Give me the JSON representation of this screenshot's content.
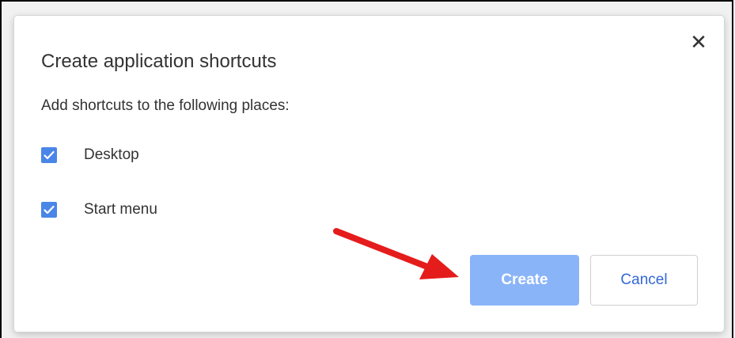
{
  "dialog": {
    "title": "Create application shortcuts",
    "subtitle": "Add shortcuts to the following places:",
    "close_icon": "close-icon",
    "options": [
      {
        "label": "Desktop",
        "checked": true
      },
      {
        "label": "Start menu",
        "checked": true
      }
    ],
    "buttons": {
      "create_label": "Create",
      "cancel_label": "Cancel"
    }
  },
  "annotation": {
    "arrow_icon": "red-arrow-icon",
    "arrow_color": "#e51c1c"
  },
  "colors": {
    "checkbox": "#4a86e8",
    "create_button": "#8ab4f8",
    "cancel_text": "#3367d6"
  }
}
